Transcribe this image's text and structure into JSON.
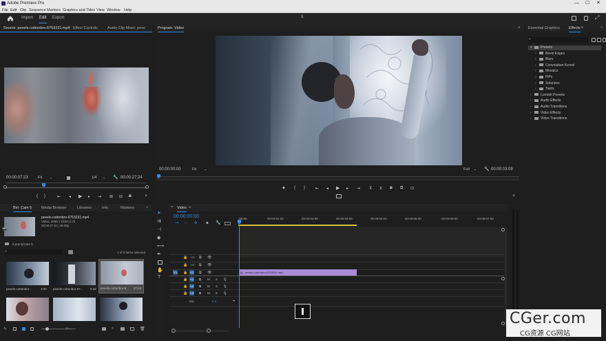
{
  "app": {
    "title": "Adobe Premiere Pro",
    "menus": [
      "File",
      "Edit",
      "Clip",
      "Sequence",
      "Markers",
      "Graphics and Titles",
      "View",
      "Window",
      "Help"
    ],
    "nav": {
      "import": "Import",
      "edit": "Edit",
      "export": "Export"
    },
    "center_indicator": "9"
  },
  "source_panel": {
    "tabs": [
      "Source: pexels-cottonbro-6753231.mp4",
      "Effect Controls",
      "Audio Clip Mixer: pexe"
    ],
    "timecode_current": "00:00:07:23",
    "fit": "Fit",
    "resolution": "1/4",
    "timecode_duration": "00:00:27:24"
  },
  "program_panel": {
    "tab": "Program: Video",
    "timecode_current": "00:00:00:00",
    "fit": "Fit",
    "resolution": "Full",
    "timecode_duration": "00:00:03:09"
  },
  "effects_panel": {
    "tabs": [
      "Essential Graphics",
      "Effects"
    ],
    "tree": [
      {
        "label": "Presets",
        "level": 0,
        "expanded": true,
        "selected": true
      },
      {
        "label": "Bevel Edges",
        "level": 1
      },
      {
        "label": "Blurs",
        "level": 1
      },
      {
        "label": "Convolution Kernel",
        "level": 1
      },
      {
        "label": "Mosaics",
        "level": 1
      },
      {
        "label": "PiPs",
        "level": 1
      },
      {
        "label": "Solarizes",
        "level": 1
      },
      {
        "label": "Twirls",
        "level": 1
      },
      {
        "label": "Lumetri Presets",
        "level": 0
      },
      {
        "label": "Audio Effects",
        "level": 0
      },
      {
        "label": "Audio Transitions",
        "level": 0
      },
      {
        "label": "Video Effects",
        "level": 0
      },
      {
        "label": "Video Transitions",
        "level": 0
      }
    ]
  },
  "project_panel": {
    "tabs": [
      "Bin: Cam 5",
      "Media Browser",
      "Libraries",
      "Info",
      "Markers"
    ],
    "clip_name": "pexels-cottonbro-6753231.mp4",
    "clip_info": "Video, 4096 x 2160 (1.0)",
    "clip_info2": "00:00:27:24, 25.00p",
    "bin_path": "9.prproj\\Cam 5",
    "items_selected": "1 of 6 items selected",
    "thumbs": [
      {
        "label": "pexels-cottonbro...",
        "dur": "3:09"
      },
      {
        "label": "pexels-cottonbro-67...",
        "dur": "5:24"
      },
      {
        "label": "pexels-cottonbro-6...",
        "dur": "27:24"
      },
      {
        "label": "",
        "dur": ""
      },
      {
        "label": "",
        "dur": ""
      },
      {
        "label": "",
        "dur": ""
      }
    ]
  },
  "timeline": {
    "tab": "Video",
    "timecode": "00:00:00:00",
    "ruler": [
      ":00:00",
      "00:00:01:00",
      "00:00:02:00",
      "00:00:03:00",
      "00:00:04:00",
      "00:00:05:00",
      "00:00:06:00",
      "00:00:07:00"
    ],
    "video_tracks": [
      "V3",
      "V2",
      "V1"
    ],
    "audio_tracks": [
      "A1",
      "A2",
      "A3"
    ],
    "source_v": "V1",
    "mix_label": "Mix",
    "mix_value": "0.0",
    "clip_label": "pexels-cottonbro-6753231.mp4"
  },
  "watermark": {
    "main": "CGer.com",
    "sub": "CG资源 CG网站"
  },
  "colors": {
    "accent": "#2d8ceb",
    "clip": "#a98cd8",
    "work_area": "#d6c23a"
  }
}
